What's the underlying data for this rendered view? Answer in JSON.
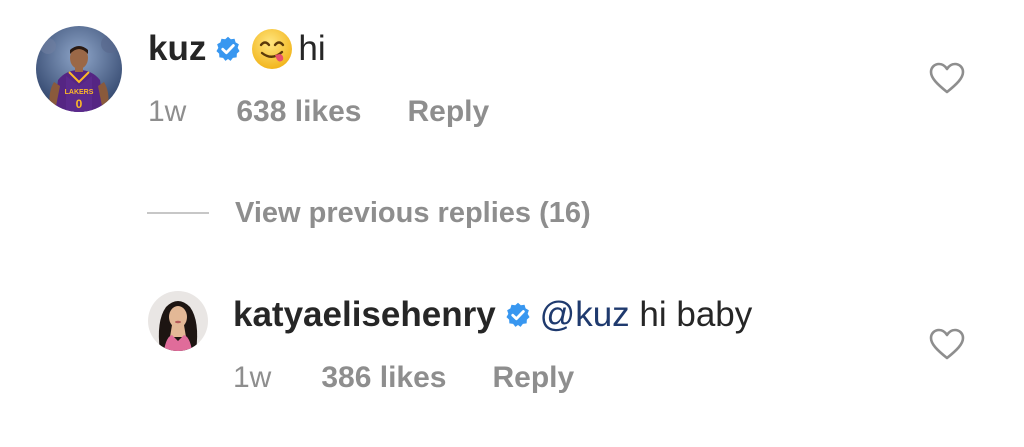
{
  "comments": [
    {
      "username": "kuz",
      "verified": true,
      "emoji": "yum-face",
      "text": "hi",
      "time": "1w",
      "likes": "638 likes",
      "reply_label": "Reply"
    },
    {
      "username": "katyaelisehenry",
      "verified": true,
      "mention": "@kuz",
      "text": " hi baby",
      "time": "1w",
      "likes": "386 likes",
      "reply_label": "Reply"
    }
  ],
  "view_replies": {
    "label": "View previous replies (16)"
  },
  "colors": {
    "text_primary": "#262626",
    "text_secondary": "#8e8e8e",
    "verified_blue": "#3897f0",
    "mention": "#1f3a6e"
  },
  "icons": {
    "verified": "verified-badge-icon",
    "heart": "heart-outline-icon"
  }
}
